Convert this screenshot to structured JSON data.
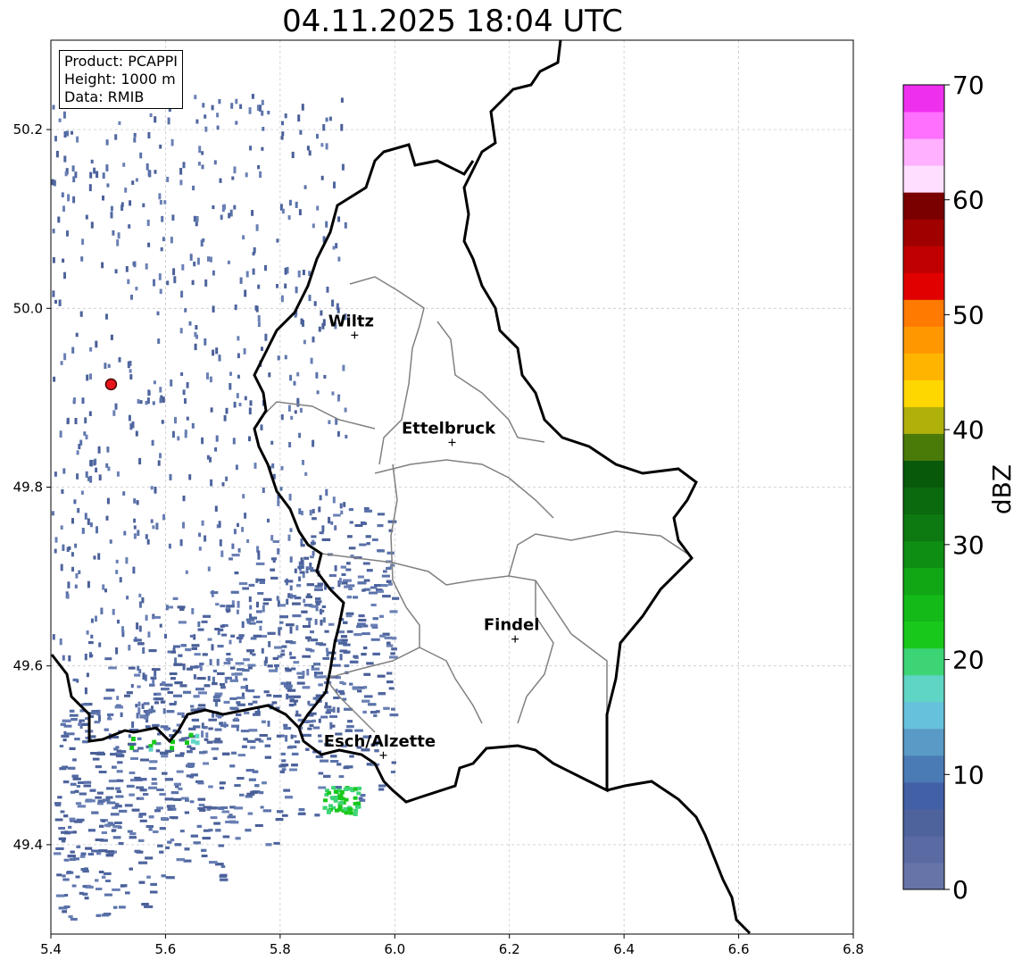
{
  "title": "04.11.2025 18:04 UTC",
  "info": {
    "product": "Product: PCAPPI",
    "height": "Height: 1000 m",
    "data": "Data: RMIB"
  },
  "axes": {
    "x_ticks": [
      "5.4",
      "5.6",
      "5.8",
      "6.0",
      "6.2",
      "6.4",
      "6.6",
      "6.8"
    ],
    "y_ticks": [
      "50.2",
      "50.0",
      "49.8",
      "49.6",
      "49.4"
    ],
    "xlim": [
      5.4,
      6.8
    ],
    "ylim": [
      49.3,
      50.3
    ],
    "grid": true
  },
  "cities": [
    {
      "name": "Wiltz",
      "lon": 5.93,
      "lat": 49.97
    },
    {
      "name": "Ettelbruck",
      "lon": 6.1,
      "lat": 49.85
    },
    {
      "name": "Findel",
      "lon": 6.21,
      "lat": 49.63
    },
    {
      "name": "Esch/Alzette",
      "lon": 5.98,
      "lat": 49.5
    }
  ],
  "radar_site": {
    "lon": 5.505,
    "lat": 49.915,
    "color": "#e8141c"
  },
  "colorbar": {
    "label": "dBZ",
    "ticks": [
      "0",
      "10",
      "20",
      "30",
      "40",
      "50",
      "60",
      "70"
    ],
    "colors": [
      "#6674a8",
      "#5a6aa2",
      "#4e629c",
      "#4260a6",
      "#4b7bb5",
      "#5a9ac6",
      "#66c2dc",
      "#5fd5c5",
      "#3dd475",
      "#18c81a",
      "#14ba18",
      "#10a614",
      "#0e8e12",
      "#0c7a10",
      "#0a6a0e",
      "#085a0a",
      "#4a7a08",
      "#b0b00a",
      "#ffd700",
      "#ffb400",
      "#ff9800",
      "#ff7a00",
      "#e00000",
      "#c00000",
      "#a00000",
      "#7a0000",
      "#ffdfff",
      "#ffb0ff",
      "#ff70ff",
      "#ee30ee"
    ]
  }
}
